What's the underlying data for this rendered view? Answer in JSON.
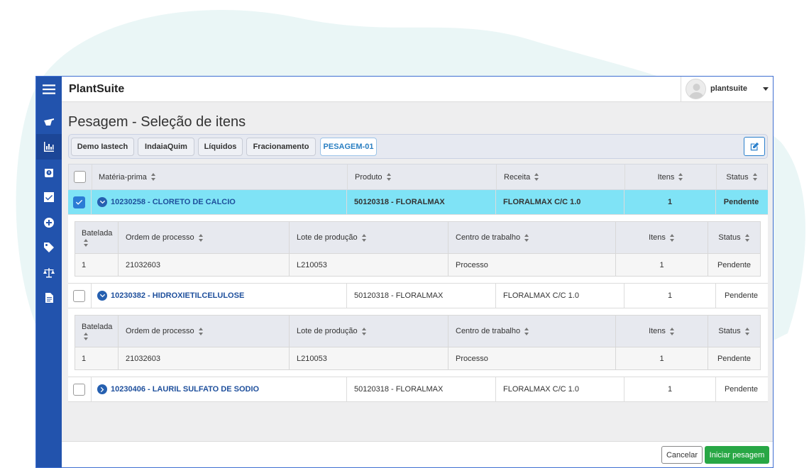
{
  "app": {
    "brand": "PlantSuite",
    "username": "plantsuite"
  },
  "sidebar": {
    "items": [
      {
        "icon": "menu-icon"
      },
      {
        "icon": "flask-icon"
      },
      {
        "icon": "chart-icon"
      },
      {
        "icon": "scale-icon"
      },
      {
        "icon": "checkbox-icon"
      },
      {
        "icon": "plus-circle-icon"
      },
      {
        "icon": "tag-icon"
      },
      {
        "icon": "balance-icon"
      },
      {
        "icon": "document-icon"
      }
    ]
  },
  "page": {
    "title": "Pesagem - Seleção de itens"
  },
  "breadcrumb": [
    "Demo Iastech",
    "IndaiaQuim",
    "Líquidos",
    "Fracionamento",
    "PESAGEM-01"
  ],
  "table": {
    "headers": {
      "material": "Matéria-prima",
      "product": "Produto",
      "recipe": "Receita",
      "items": "Itens",
      "status": "Status"
    },
    "rows": [
      {
        "material": "10230258 - CLORETO DE CALCIO",
        "product": "50120318 - FLORALMAX",
        "recipe": "FLORALMAX C/C 1.0",
        "items": "1",
        "status": "Pendente"
      },
      {
        "material": "10230382 - HIDROXIETILCELULOSE",
        "product": "50120318 - FLORALMAX",
        "recipe": "FLORALMAX C/C 1.0",
        "items": "1",
        "status": "Pendente"
      },
      {
        "material": "10230406 - LAURIL SULFATO DE SODIO",
        "product": "50120318 - FLORALMAX",
        "recipe": "FLORALMAX C/C 1.0",
        "items": "1",
        "status": "Pendente"
      }
    ]
  },
  "subtable": {
    "headers": {
      "batch": "Batelada",
      "order": "Ordem de processo",
      "lot": "Lote de produção",
      "center": "Centro de trabalho",
      "items": "Itens",
      "status": "Status"
    },
    "rows": [
      {
        "batch": "1",
        "order": "21032603",
        "lot": "L210053",
        "center": "Processo",
        "items": "1",
        "status": "Pendente"
      },
      {
        "batch": "1",
        "order": "21032603",
        "lot": "L210053",
        "center": "Processo",
        "items": "1",
        "status": "Pendente"
      }
    ]
  },
  "footer": {
    "cancel": "Cancelar",
    "start": "Iniciar pesagem"
  },
  "colors": {
    "sidebar": "#2253ad",
    "selected_row": "#7fe3f6",
    "primary_button": "#28a745",
    "link": "#1e4f9c"
  }
}
